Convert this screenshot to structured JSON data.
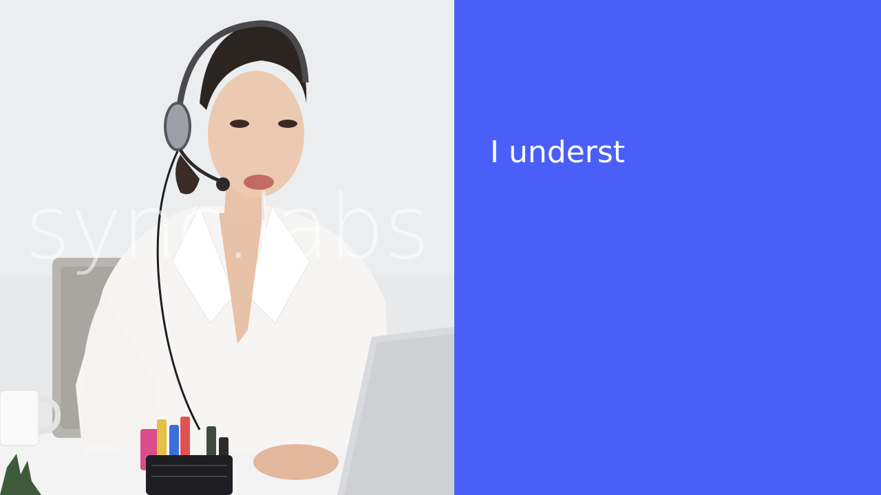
{
  "video": {
    "scene": "customer-support-agent-with-headset",
    "watermark": "sync.labs"
  },
  "caption": {
    "text": "I underst"
  },
  "colors": {
    "caption_background": "#4a5ff7",
    "caption_text": "#ffffff",
    "video_background": "#e9eaec"
  }
}
